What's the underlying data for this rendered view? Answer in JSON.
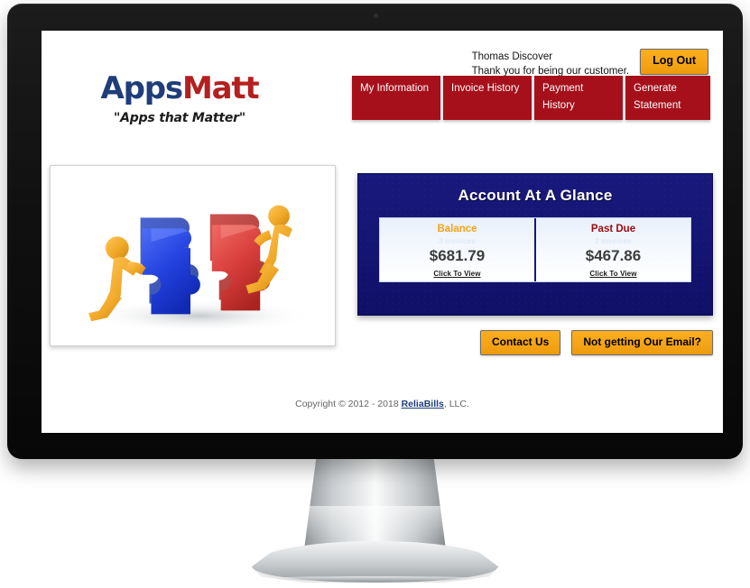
{
  "brand": {
    "logo_first": "Apps",
    "logo_second": "Matt",
    "tagline": "\"Apps that Matter\""
  },
  "header": {
    "customer_name": "Thomas Discover",
    "thank_you": "Thank you for being our customer.",
    "logout_label": "Log Out"
  },
  "nav": {
    "tabs": [
      {
        "line1": "My Information",
        "line2": ""
      },
      {
        "line1": "Invoice History",
        "line2": ""
      },
      {
        "line1": "Payment",
        "line2": "History"
      },
      {
        "line1": "Generate",
        "line2": "Statement"
      }
    ]
  },
  "hero": {
    "alt": "two figures pushing blue and red puzzle pieces together",
    "piece_left_color": "#1b3fd8",
    "piece_right_color": "#d33a3a",
    "figure_color": "#f0a828"
  },
  "account_panel": {
    "title": "Account At A Glance",
    "cards": [
      {
        "label": "Balance",
        "sub": "3 invoices",
        "amount": "$681.79",
        "link": "Click To View",
        "label_color": "#f5a31a"
      },
      {
        "label": "Past Due",
        "sub": "2 invoices",
        "amount": "$467.86",
        "link": "Click To View",
        "label_color": "#9e0b10"
      }
    ]
  },
  "actions": {
    "contact_label": "Contact Us",
    "email_label": "Not getting Our Email?"
  },
  "footer": {
    "prefix": "Copyright © 2012 - 2018 ",
    "link": "ReliaBills",
    "suffix": ", LLC."
  },
  "theme": {
    "nav_red": "#a6101a",
    "panel_navy": "#16167a",
    "accent_orange": "#f5a517",
    "logo_blue": "#1f3d7a",
    "logo_red": "#b51f1f"
  }
}
